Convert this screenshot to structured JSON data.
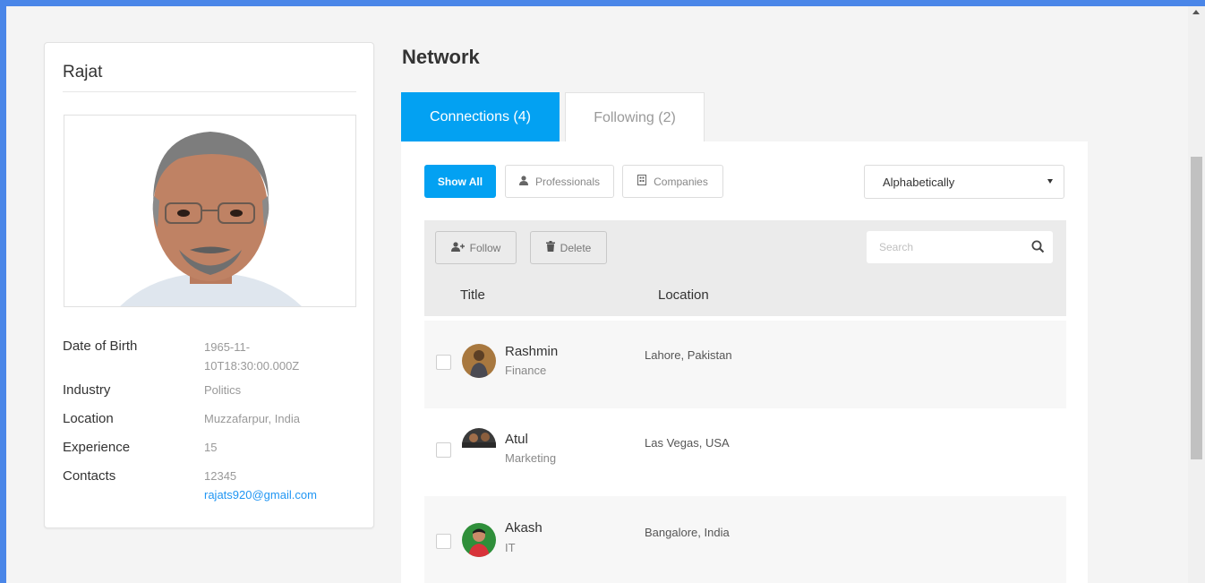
{
  "profile": {
    "name": "Rajat",
    "fields": [
      {
        "label": "Date of Birth",
        "value_line1": "1965-11-",
        "value_line2": "10T18:30:00.000Z"
      },
      {
        "label": "Industry",
        "value": "Politics"
      },
      {
        "label": "Location",
        "value": "Muzzafarpur, India"
      },
      {
        "label": "Experience",
        "value": "15"
      },
      {
        "label": "Contacts",
        "value": "12345",
        "email": "rajats920@gmail.com"
      }
    ]
  },
  "network": {
    "title": "Network",
    "tabs": [
      {
        "label": "Connections (4)",
        "active": true
      },
      {
        "label": "Following (2)",
        "active": false
      }
    ],
    "filters": {
      "show_all": "Show All",
      "professionals": "Professionals",
      "companies": "Companies"
    },
    "sort": {
      "selected": "Alphabetically"
    },
    "toolbar": {
      "follow": "Follow",
      "delete": "Delete",
      "search_placeholder": "Search"
    },
    "columns": {
      "title": "Title",
      "location": "Location"
    },
    "rows": [
      {
        "name": "Rashmin",
        "industry": "Finance",
        "location": "Lahore, Pakistan"
      },
      {
        "name": "Atul",
        "industry": "Marketing",
        "location": "Las Vegas, USA"
      },
      {
        "name": "Akash",
        "industry": "IT",
        "location": "Bangalore, India"
      }
    ]
  },
  "colors": {
    "accent": "#03a1f2",
    "frame": "#4a86e8",
    "email": "#2196f3"
  }
}
